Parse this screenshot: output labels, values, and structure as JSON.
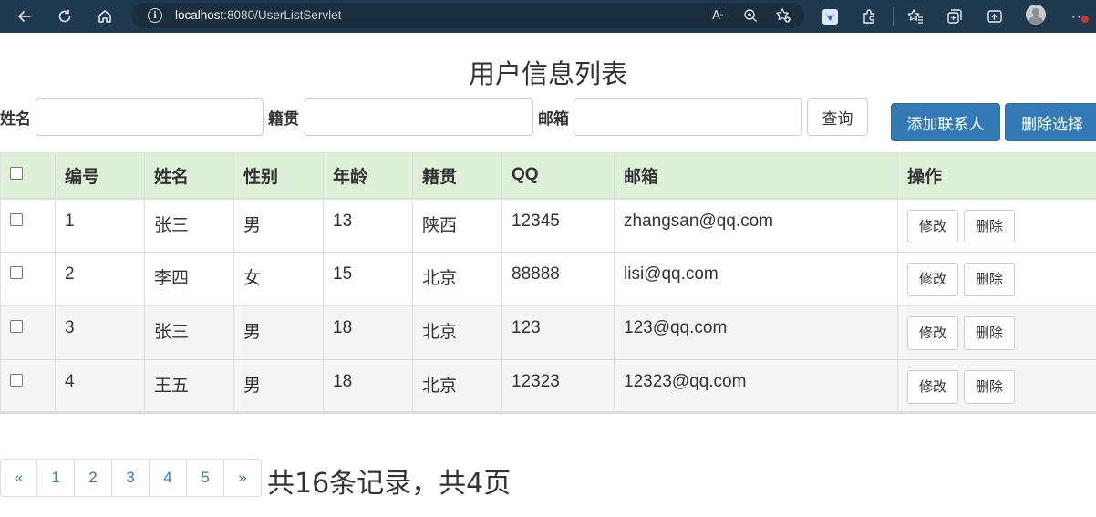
{
  "browser": {
    "url_host": "localhost",
    "url_rest": ":8080/UserListServlet"
  },
  "page": {
    "title": "用户信息列表"
  },
  "search": {
    "name_label": "姓名",
    "name_value": "",
    "origin_label": "籍贯",
    "origin_value": "",
    "email_label": "邮箱",
    "email_value": "",
    "query_button": "查询"
  },
  "actions": {
    "add_button": "添加联系人",
    "delete_selected_button": "删除选择"
  },
  "table": {
    "headers": [
      "编号",
      "姓名",
      "性别",
      "年龄",
      "籍贯",
      "QQ",
      "邮箱",
      "操作"
    ],
    "rows": [
      {
        "id": "1",
        "name": "张三",
        "gender": "男",
        "age": "13",
        "origin": "陕西",
        "qq": "12345",
        "email": "zhangsan@qq.com"
      },
      {
        "id": "2",
        "name": "李四",
        "gender": "女",
        "age": "15",
        "origin": "北京",
        "qq": "88888",
        "email": "lisi@qq.com"
      },
      {
        "id": "3",
        "name": "张三",
        "gender": "男",
        "age": "18",
        "origin": "北京",
        "qq": "123",
        "email": "123@qq.com"
      },
      {
        "id": "4",
        "name": "王五",
        "gender": "男",
        "age": "18",
        "origin": "北京",
        "qq": "12323",
        "email": "12323@qq.com"
      }
    ],
    "edit_label": "修改",
    "delete_label": "删除"
  },
  "pagination": {
    "prev": "«",
    "pages": [
      "1",
      "2",
      "3",
      "4",
      "5"
    ],
    "next": "»",
    "summary": "共16条记录，共4页"
  },
  "colors": {
    "header_bg": "#dff0d8",
    "primary": "#337ab7",
    "browser_bar": "#1f3a4f"
  }
}
